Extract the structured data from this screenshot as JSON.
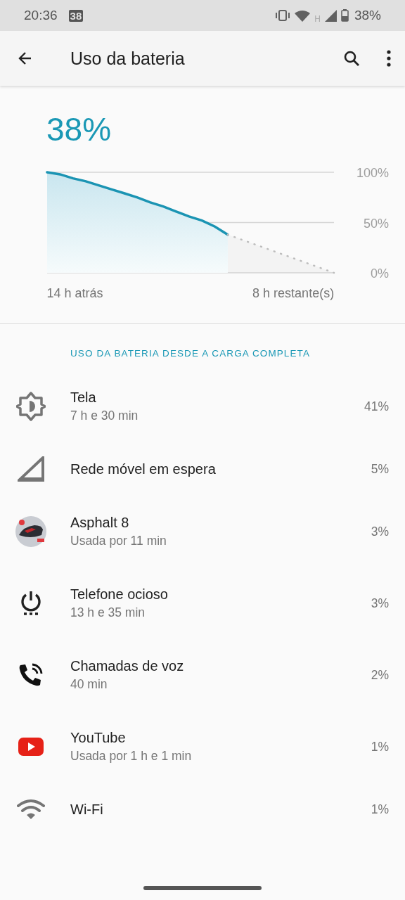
{
  "status_bar": {
    "time": "20:36",
    "notification_badge": "38",
    "network_type": "H",
    "battery_text": "38%"
  },
  "toolbar": {
    "title": "Uso da bateria"
  },
  "battery": {
    "percent": "38%",
    "chart_data": {
      "type": "area",
      "x": [
        -16.8,
        -15.5,
        -14.2,
        -12.9,
        -11.6,
        -10.3,
        -9,
        -7.7,
        -6.4,
        -5.1,
        -3.8,
        -2.5,
        -1.2,
        0.1,
        1.4,
        12.1
      ],
      "series": [
        {
          "color": "#1b94b3",
          "values": [
            100,
            98,
            94,
            91,
            87,
            83,
            79,
            75,
            70,
            66,
            61,
            56,
            52,
            46,
            38,
            null
          ]
        },
        {
          "color": "#bdbdbd",
          "values": [
            null,
            null,
            null,
            null,
            null,
            null,
            null,
            null,
            null,
            null,
            null,
            null,
            null,
            null,
            38,
            0
          ]
        }
      ],
      "xlim": [
        -16.8,
        12.1
      ],
      "ylim": [
        0,
        100
      ],
      "xticks": [
        {
          "value": -14,
          "label": "14 h atrás"
        },
        {
          "value": 8,
          "label": "8 h restante(s)"
        }
      ],
      "yticks": [
        {
          "value": 0,
          "label": "0%"
        },
        {
          "value": 50,
          "label": "50%"
        },
        {
          "value": 100,
          "label": "100%"
        }
      ]
    }
  },
  "section_header": "USO DA BATERIA DESDE A CARGA COMPLETA",
  "items": [
    {
      "title": "Tela",
      "subtitle": "7 h e 30 min",
      "percent": "41%"
    },
    {
      "title": "Rede móvel em espera",
      "percent": "5%"
    },
    {
      "title": "Asphalt 8",
      "subtitle": "Usada por 11 min",
      "percent": "3%"
    },
    {
      "title": "Telefone ocioso",
      "subtitle": "13 h e 35 min",
      "percent": "3%"
    },
    {
      "title": "Chamadas de voz",
      "subtitle": "40 min",
      "percent": "2%"
    },
    {
      "title": "YouTube",
      "subtitle": "Usada por 1 h e 1 min",
      "percent": "1%"
    },
    {
      "title": "Wi-Fi",
      "percent": "1%"
    }
  ]
}
